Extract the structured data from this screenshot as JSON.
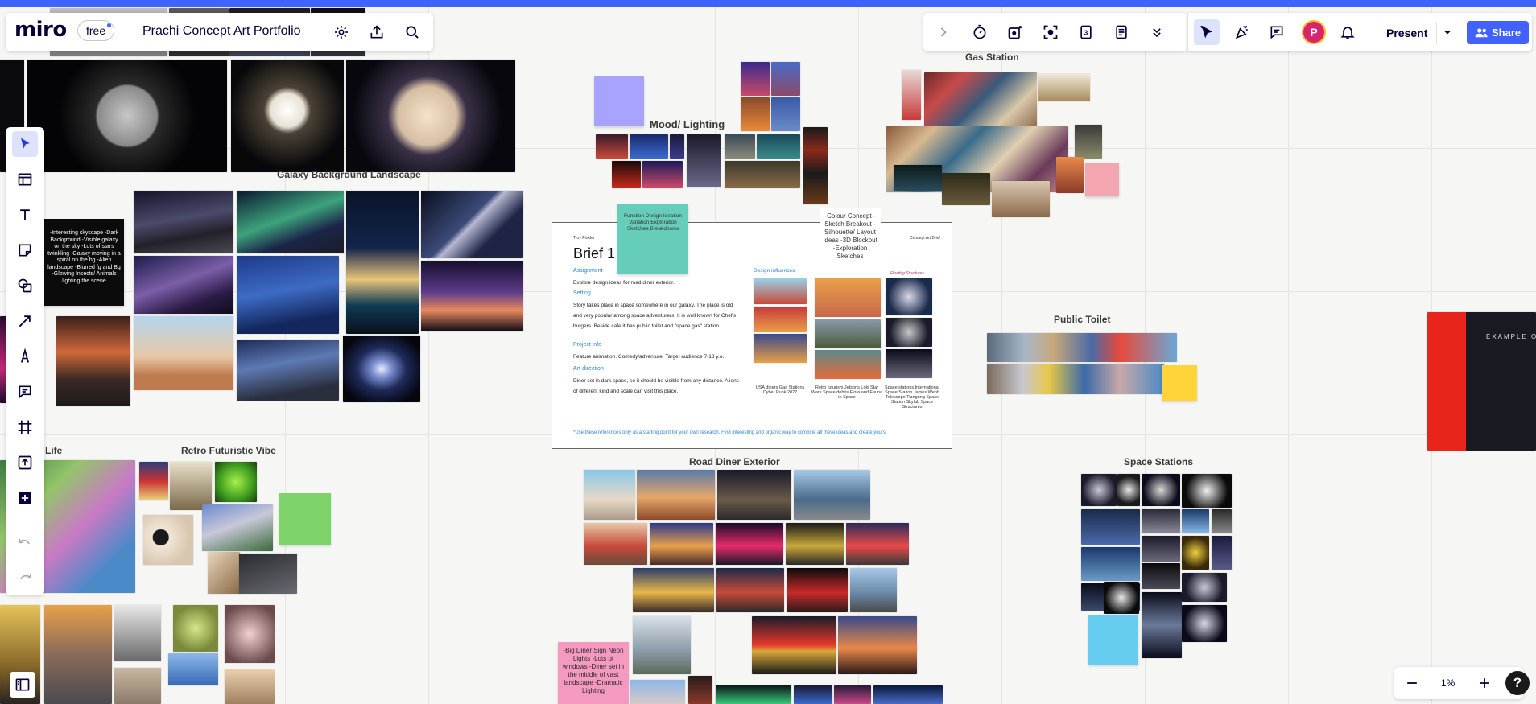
{
  "app": {
    "logo": "miro",
    "plan_badge": "free",
    "board_title": "Prachi Concept Art Portfolio",
    "accent": "#4262ff"
  },
  "toolbar": {
    "present_label": "Present",
    "share_label": "Share",
    "avatar_initial": "P",
    "icons": [
      "chevron-right-icon",
      "timer-icon",
      "voting-icon",
      "focus-frame-icon",
      "counter-icon",
      "notes-icon",
      "chevrons-down-icon",
      "select-mode-icon",
      "reactions-icon",
      "comments-icon",
      "notifications-icon"
    ]
  },
  "left_toolbar": {
    "tools": [
      "select-tool-icon",
      "templates-icon",
      "text-tool-icon",
      "sticky-note-icon",
      "shapes-icon",
      "connector-icon",
      "pen-icon",
      "comment-icon",
      "frame-icon",
      "upload-icon",
      "more-tools-icon"
    ],
    "undo": "undo-icon",
    "redo": "redo-icon"
  },
  "zoom": {
    "value": "1%",
    "minus": "zoom-out-icon",
    "plus": "zoom-in-icon",
    "help": "?"
  },
  "board": {
    "frames": {
      "galaxy": "Galaxy Background Landscape",
      "mood": "Mood/ Lighting",
      "gas_station": "Gas Station",
      "public_toilet": "Public Toilet",
      "retro": "Retro Futuristic Vibe",
      "life": "Life",
      "diner": "Road Diner Exterior",
      "space_stations": "Space Stations",
      "example": "EXAMPLE OF"
    },
    "stickies": {
      "galaxy_note": "-Interesting skyscape -Dark Background -Visible galaxy on the sky -Lots of stars twinkling -Galaxy moving in a spiral on the bg -Alien landscape -Blurred fg and Bg -Glowing Insects/ Animals lighting the scene",
      "concept_list": "-Colour Concept -Sketch Breakout -Silhouette/ Layout Ideas -3D Blockout -Exploration Sketches",
      "teal_note": "Function Design Ideation Variation Exploration Sketches Breakdowns",
      "diner_note": "-Big Diner Sign Neon Lights -Lots of windows -Diner set in the middle of vast landscape -Dramatic Lighting"
    },
    "brief": {
      "title": "Brief 1",
      "sections": {
        "assignment": "Assignment",
        "setting": "Setting",
        "project_info": "Project info",
        "art_direction": "Art-direction"
      },
      "assignment_text": "Explore design ideas for road diner exterior.",
      "setting_text": "Story takes place in space somewhere in our galaxy. The place is old and very popular among space adventurers. It is well known for Chef's burgers. Beside cafe it has public toilet and \"space gas\" station.",
      "project_text": "Feature animation. Comedy/adventure. Target audience 7-13 y.o.",
      "art_text": "Diner set in dark space, so it should be visible from any distance. Aliens of different kind and scale can visit this place.",
      "design_influences": "Design influences",
      "col1_caption": "USA diners Gas Stations Cyber Punk 2077",
      "col2_caption": "Retro futurism Jetsons Loki Star Wars Space debris Flora and Fauna in Space",
      "col3_caption": "Space stations International Space Station James Webb Telescope Tiangong Space Station Skylab Space Structures",
      "floating_label": "Floating Structures",
      "footnote": "*Use these references only as a starting point for your own research. Find interesting and organic way to combine all these ideas and create yours."
    }
  }
}
